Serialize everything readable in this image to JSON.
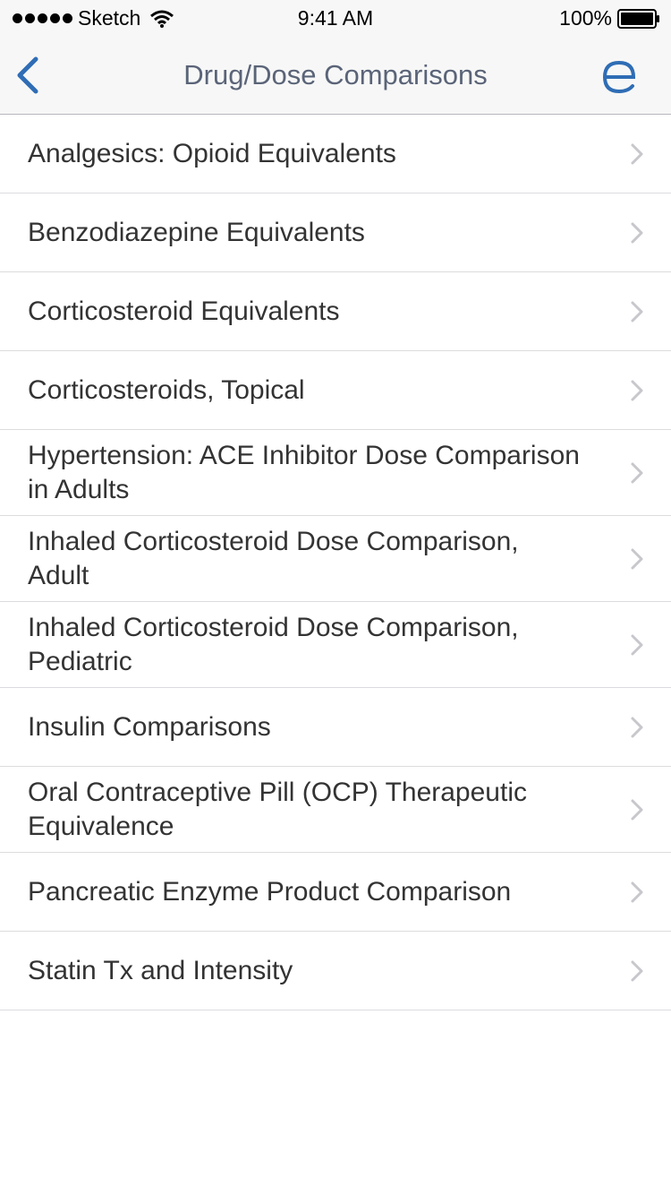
{
  "status": {
    "carrier": "Sketch",
    "time": "9:41 AM",
    "battery": "100%"
  },
  "nav": {
    "title": "Drug/Dose Comparisons",
    "back_icon": "chevron-left-icon",
    "brand_icon": "epocrates-e-icon",
    "accent": "#2f6db5"
  },
  "items": [
    {
      "label": "Analgesics: Opioid Equivalents"
    },
    {
      "label": "Benzodiazepine Equivalents"
    },
    {
      "label": "Corticosteroid Equivalents"
    },
    {
      "label": "Corticosteroids, Topical"
    },
    {
      "label": "Hypertension: ACE Inhibitor Dose Comparison in Adults"
    },
    {
      "label": "Inhaled Corticosteroid Dose Comparison, Adult"
    },
    {
      "label": "Inhaled Corticosteroid Dose Comparison, Pediatric"
    },
    {
      "label": "Insulin Comparisons"
    },
    {
      "label": "Oral Contraceptive Pill (OCP) Therapeutic Equivalence"
    },
    {
      "label": "Pancreatic Enzyme Product Comparison"
    },
    {
      "label": "Statin Tx and Intensity"
    }
  ]
}
